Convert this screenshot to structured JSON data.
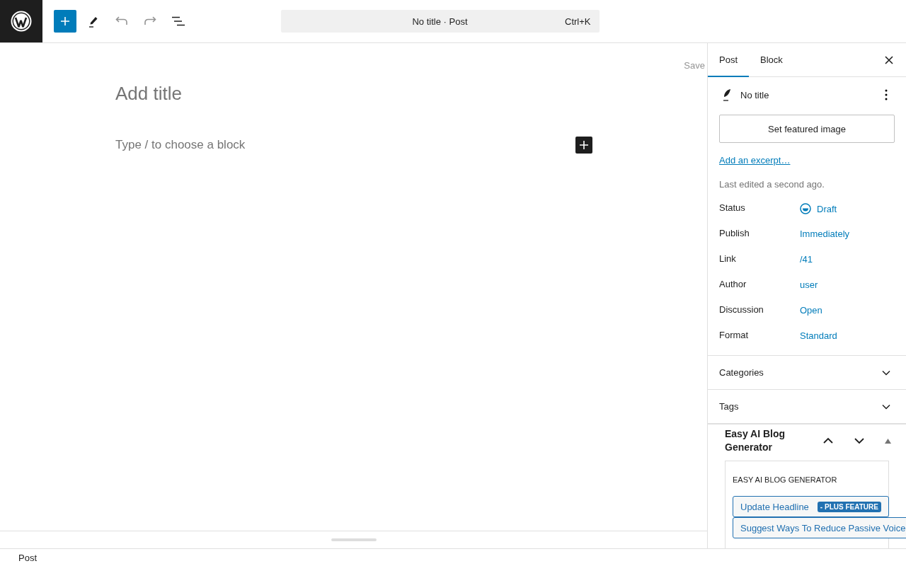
{
  "toolbar": {
    "tools": [
      {
        "kind": "add",
        "disabled": false
      },
      {
        "kind": "edit",
        "disabled": false
      },
      {
        "kind": "undo",
        "disabled": true
      },
      {
        "kind": "redo",
        "disabled": true
      },
      {
        "kind": "outline",
        "disabled": false
      }
    ],
    "command": {
      "title": "No title · Post",
      "shortcut": "Ctrl+K"
    }
  },
  "editor": {
    "save": "Save",
    "title_placeholder": "Add title",
    "block_placeholder": "Type / to choose a block"
  },
  "sidebar": {
    "tabs": [
      {
        "label": "Post",
        "selected": true
      },
      {
        "label": "Block",
        "selected": false
      }
    ],
    "post_title": "No title",
    "featured_button": "Set featured image",
    "excerpt_link": "Add an excerpt…",
    "last_edited": "Last edited a second ago.",
    "fields": [
      {
        "label": "Status",
        "value": "Draft",
        "kind": "status"
      },
      {
        "label": "Publish",
        "value": "Immediately",
        "kind": "plain"
      },
      {
        "label": "Link",
        "value": "/41",
        "kind": "plain"
      },
      {
        "label": "Author",
        "value": "user",
        "kind": "plain"
      },
      {
        "label": "Discussion",
        "value": "Open",
        "kind": "plain"
      },
      {
        "label": "Format",
        "value": "Standard",
        "kind": "plain"
      }
    ],
    "panels": [
      {
        "title": "Categories",
        "expanded": false
      },
      {
        "title": "Tags",
        "expanded": false
      }
    ],
    "plugin": {
      "title": "Easy AI Blog Generator",
      "heading": "EASY AI BLOG GENERATOR",
      "actions": [
        {
          "label": "Update Headline",
          "badge": "- PLUS FEATURE"
        },
        {
          "label": "Suggest Ways To Reduce Passive Voice"
        }
      ]
    }
  },
  "status_bar": {
    "breadcrumb": "Post"
  }
}
